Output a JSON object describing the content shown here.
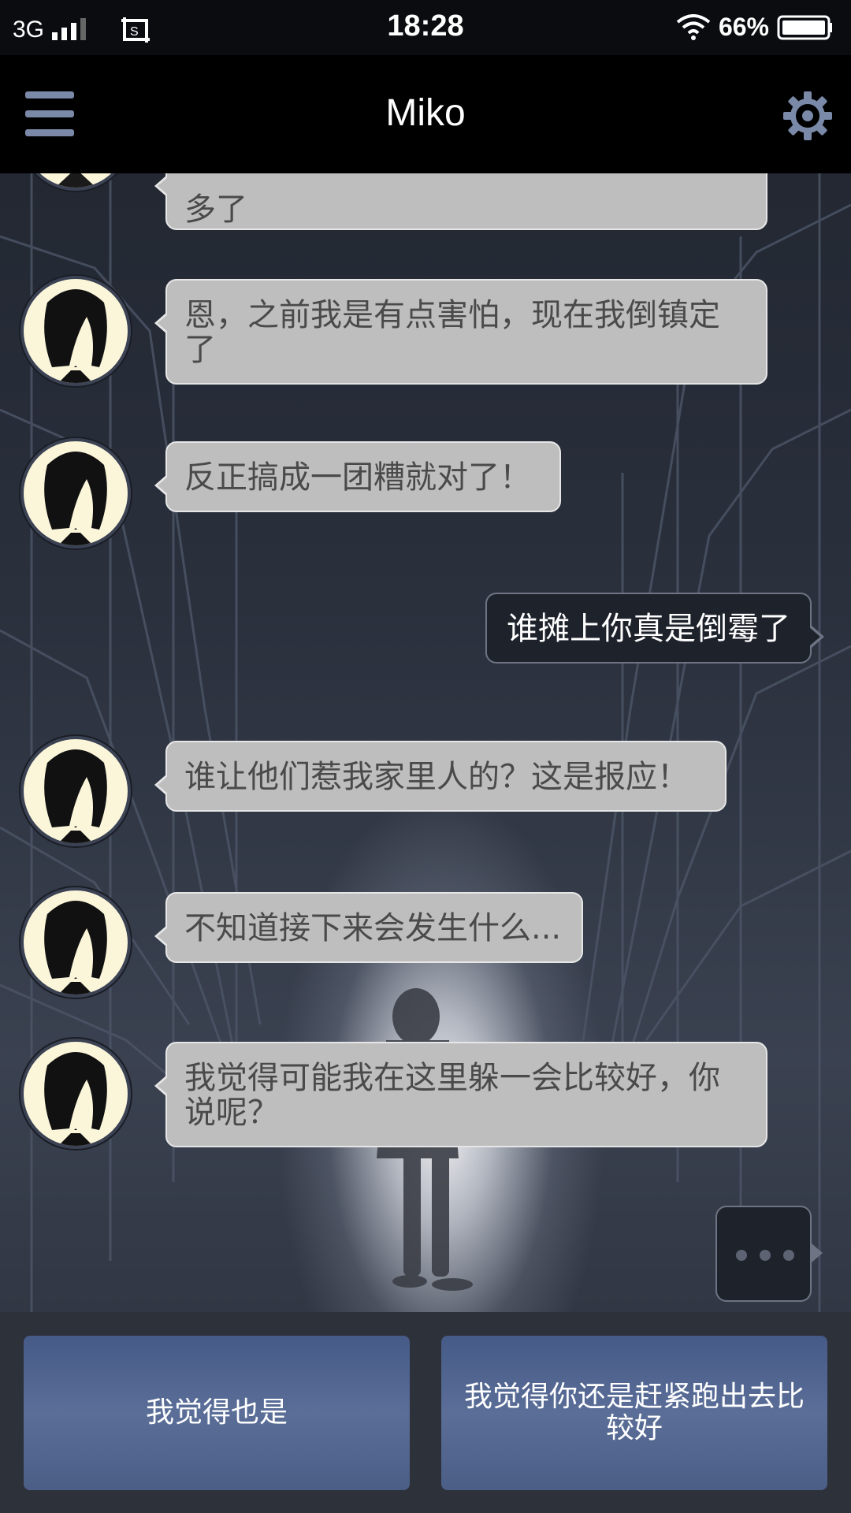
{
  "status_bar": {
    "network": "3G",
    "time": "18:28",
    "battery_percent": "66%",
    "icons": [
      "signal-icon",
      "screenshot-icon",
      "wifi-icon",
      "battery-icon"
    ]
  },
  "app_bar": {
    "title": "Miko",
    "menu_icon": "menu-icon",
    "settings_icon": "gear-icon"
  },
  "messages": [
    {
      "side": "left",
      "text": "多了"
    },
    {
      "side": "left",
      "text": "恩，之前我是有点害怕，现在我倒镇定了"
    },
    {
      "side": "left",
      "text": "反正搞成一团糟就对了！"
    },
    {
      "side": "right",
      "text": "谁摊上你真是倒霉了"
    },
    {
      "side": "left",
      "text": "谁让他们惹我家里人的？这是报应！"
    },
    {
      "side": "left",
      "text": "不知道接下来会发生什么..."
    },
    {
      "side": "left",
      "text": "我觉得可能我在这里躲一会比较好，你说呢？"
    }
  ],
  "choices": [
    {
      "label": "我觉得也是"
    },
    {
      "label": "我觉得你还是赶紧跑出去比较好"
    }
  ],
  "colors": {
    "left_bubble": "#bebebe",
    "right_bubble": "#1e222b",
    "choice_button": "#5a6e98",
    "avatar_bg": "#fbf6da"
  }
}
